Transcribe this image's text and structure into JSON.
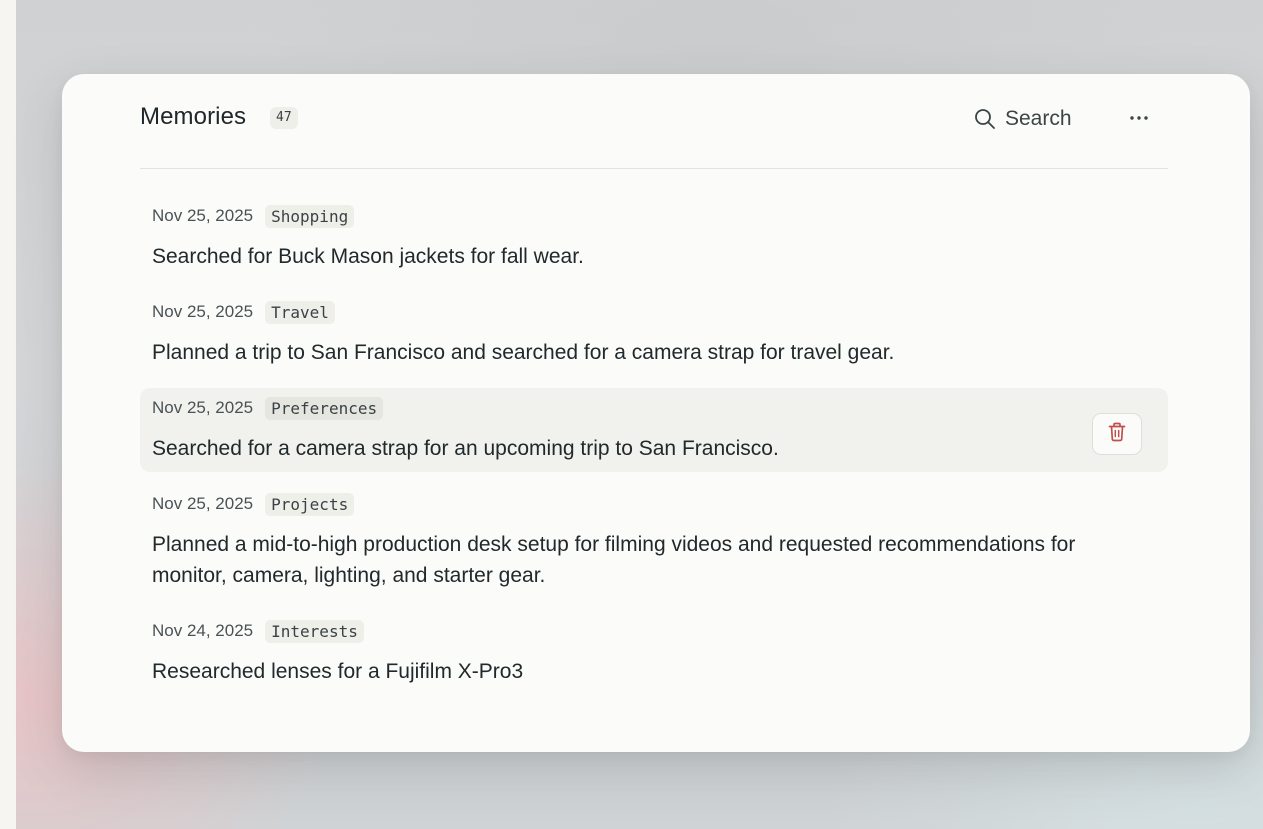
{
  "header": {
    "title": "Memories",
    "count": "47",
    "search_label": "Search"
  },
  "memories": [
    {
      "date": "Nov 25, 2025",
      "tag": "Shopping",
      "text": "Searched for Buck Mason jackets for fall wear."
    },
    {
      "date": "Nov 25, 2025",
      "tag": "Travel",
      "text": "Planned a trip to San Francisco and searched for a camera strap for travel gear."
    },
    {
      "date": "Nov 25, 2025",
      "tag": "Preferences",
      "text": "Searched for a camera strap for an upcoming trip to San Francisco."
    },
    {
      "date": "Nov 25, 2025",
      "tag": "Projects",
      "text": "Planned a mid-to-high production desk setup for filming videos and requested recommendations for monitor, camera, lighting, and starter gear."
    },
    {
      "date": "Nov 24, 2025",
      "tag": "Interests",
      "text": "Researched lenses for a Fujifilm X-Pro3"
    }
  ],
  "icons": {
    "search": "search-icon",
    "more": "more-horizontal-icon",
    "delete": "trash-icon"
  },
  "colors": {
    "delete_icon": "#c0504d"
  }
}
